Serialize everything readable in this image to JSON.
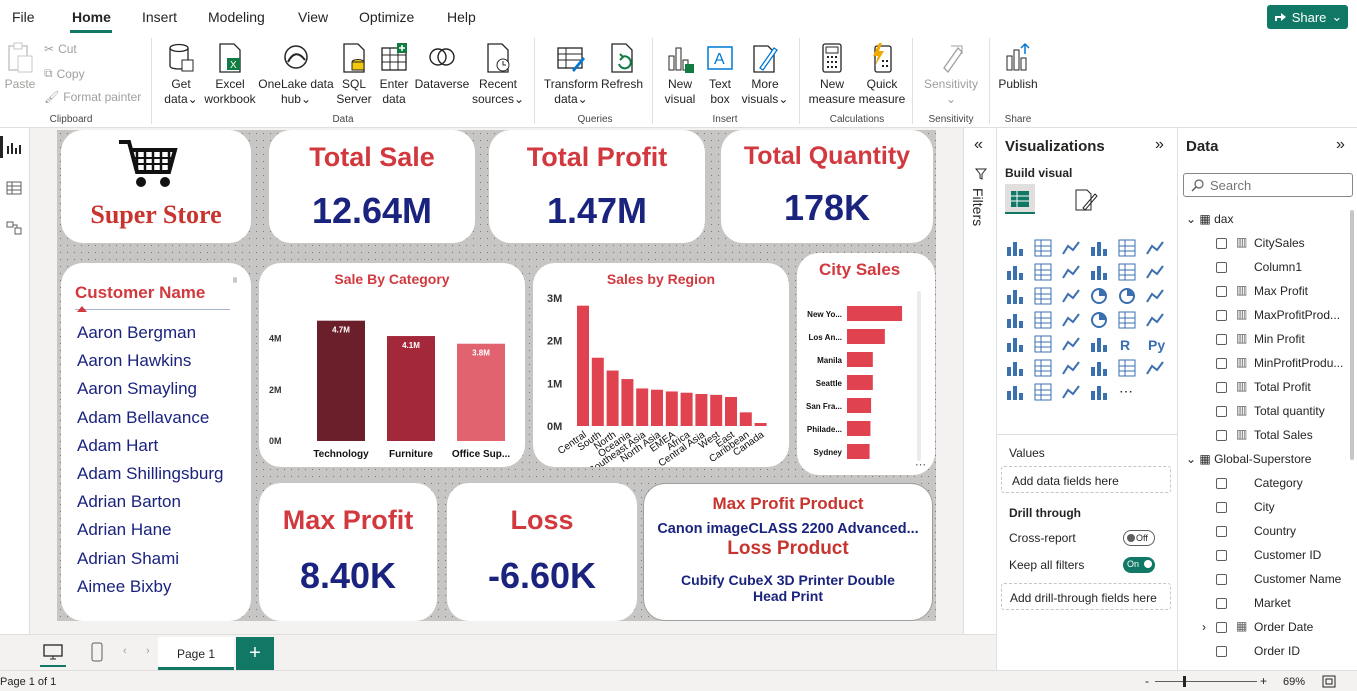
{
  "menu": {
    "items": [
      "File",
      "Home",
      "Insert",
      "Modeling",
      "View",
      "Optimize",
      "Help"
    ],
    "share": "Share"
  },
  "ribbon": {
    "clipboard": {
      "paste": "Paste",
      "cut": "Cut",
      "copy": "Copy",
      "format_painter": "Format painter",
      "group": "Clipboard"
    },
    "data": {
      "get_data": [
        "Get",
        "data"
      ],
      "excel": [
        "Excel",
        "workbook"
      ],
      "onelake": [
        "OneLake data",
        "hub"
      ],
      "sql": [
        "SQL",
        "Server"
      ],
      "enter": [
        "Enter",
        "data"
      ],
      "dataverse": "Dataverse",
      "recent": [
        "Recent",
        "sources"
      ],
      "group": "Data"
    },
    "queries": {
      "transform": [
        "Transform",
        "data"
      ],
      "refresh": "Refresh",
      "group": "Queries"
    },
    "insert": {
      "new_visual": [
        "New",
        "visual"
      ],
      "text_box": [
        "Text",
        "box"
      ],
      "more_visuals": [
        "More",
        "visuals"
      ],
      "group": "Insert"
    },
    "calculations": {
      "new_measure": [
        "New",
        "measure"
      ],
      "quick_measure": [
        "Quick",
        "measure"
      ],
      "group": "Calculations"
    },
    "sensitivity": {
      "label": "Sensitivity",
      "group": "Sensitivity"
    },
    "share": {
      "publish": "Publish",
      "group": "Share"
    }
  },
  "report": {
    "logo_title": "Super Store",
    "kpis": [
      {
        "title": "Total Sale",
        "value": "12.64M"
      },
      {
        "title": "Total Profit",
        "value": "1.47M"
      },
      {
        "title": "Total Quantity",
        "value": "178K"
      },
      {
        "title": "Max Profit",
        "value": "8.40K"
      },
      {
        "title": "Loss",
        "value": "-6.60K"
      }
    ],
    "customer_slicer": {
      "header": "Customer Name",
      "items": [
        "Aaron Bergman",
        "Aaron Hawkins",
        "Aaron Smayling",
        "Adam Bellavance",
        "Adam Hart",
        "Adam Shillingsburg",
        "Adrian Barton",
        "Adrian Hane",
        "Adrian Shami",
        "Aimee Bixby"
      ]
    },
    "max_profit_product": {
      "title": "Max Profit Product",
      "value": "Canon imageCLASS 2200 Advanced...",
      "loss_title": "Loss Product",
      "loss_value_line1": "Cubify CubeX 3D Printer Double",
      "loss_value_line2": "Head Print"
    }
  },
  "chart_data": [
    {
      "type": "bar",
      "title": "Sale By Category",
      "categories": [
        "Technology",
        "Furniture",
        "Office Sup..."
      ],
      "values": [
        4.7,
        4.1,
        3.8
      ],
      "data_labels": [
        "4.7M",
        "4.1M",
        "3.8M"
      ],
      "ytick_labels": [
        "0M",
        "2M",
        "4M"
      ],
      "ylim": [
        0,
        5
      ],
      "colors": [
        "#6b1f2a",
        "#a3283a",
        "#e0636f"
      ]
    },
    {
      "type": "bar",
      "title": "Sales by Region",
      "categories": [
        "Central",
        "South",
        "North",
        "Oceania",
        "Southeast Asia",
        "North Asia",
        "EMEA",
        "Africa",
        "Central Asia",
        "West",
        "East",
        "Caribbean",
        "Canada"
      ],
      "values": [
        2.82,
        1.6,
        1.3,
        1.1,
        0.88,
        0.85,
        0.81,
        0.78,
        0.75,
        0.73,
        0.68,
        0.32,
        0.07
      ],
      "ytick_labels": [
        "0M",
        "1M",
        "2M",
        "3M"
      ],
      "ylim": [
        0,
        3
      ],
      "color": "#e0434f"
    },
    {
      "type": "bar",
      "orientation": "horizontal",
      "title": "City Sales",
      "categories": [
        "New Yo...",
        "Los An...",
        "Manila",
        "Seattle",
        "San Fra...",
        "Philade...",
        "Sydney"
      ],
      "values": [
        256,
        176,
        120,
        120,
        112,
        109,
        105
      ],
      "xlim": [
        0,
        265
      ],
      "color": "#e0434f"
    }
  ],
  "filters": {
    "label": "Filters"
  },
  "visualizations": {
    "title": "Visualizations",
    "build_visual": "Build visual",
    "values_label": "Values",
    "add_data": "Add data fields here",
    "drill_through": "Drill through",
    "cross_report": "Cross-report",
    "cross_report_state": "Off",
    "keep_filters": "Keep all filters",
    "keep_filters_state": "On",
    "add_drill": "Add drill-through fields here"
  },
  "data_pane": {
    "title": "Data",
    "search_placeholder": "Search",
    "tables": [
      {
        "name": "dax",
        "fields": [
          {
            "name": "CitySales",
            "measure": true
          },
          {
            "name": "Column1",
            "measure": false
          },
          {
            "name": "Max Profit",
            "measure": true
          },
          {
            "name": "MaxProfitProd...",
            "measure": true
          },
          {
            "name": "Min Profit",
            "measure": true
          },
          {
            "name": "MinProfitProdu...",
            "measure": true
          },
          {
            "name": "Total Profit",
            "measure": true
          },
          {
            "name": "Total quantity",
            "measure": true
          },
          {
            "name": "Total Sales",
            "measure": true
          }
        ]
      },
      {
        "name": "Global-Superstore",
        "fields": [
          {
            "name": "Category",
            "measure": false
          },
          {
            "name": "City",
            "measure": false
          },
          {
            "name": "Country",
            "measure": false
          },
          {
            "name": "Customer ID",
            "measure": false
          },
          {
            "name": "Customer Name",
            "measure": false
          },
          {
            "name": "Market",
            "measure": false
          },
          {
            "name": "Order Date",
            "measure": false,
            "date": true
          },
          {
            "name": "Order ID",
            "measure": false
          }
        ]
      }
    ]
  },
  "pages": {
    "tabs": [
      "Page 1"
    ],
    "status": "Page 1 of 1"
  },
  "zoom": {
    "level": "69%"
  }
}
